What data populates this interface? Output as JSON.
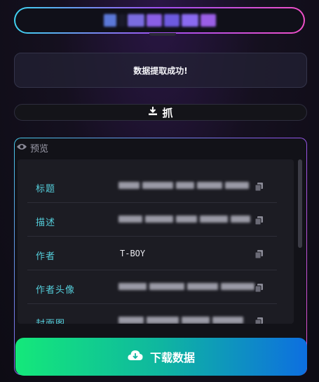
{
  "status": {
    "message": "数据提取成功!"
  },
  "grab_button": {
    "label": "抓"
  },
  "preview": {
    "label": "预览",
    "rows": [
      {
        "label": "标题",
        "value": null
      },
      {
        "label": "描述",
        "value": null
      },
      {
        "label": "作者",
        "value": "T-BOY"
      },
      {
        "label": "作者头像",
        "value": null
      },
      {
        "label": "封面图",
        "value": null
      }
    ]
  },
  "download_button": {
    "label": "下载数据"
  },
  "colors": {
    "accent_cyan": "#55cfdc",
    "gradient_start": "#14e87a",
    "gradient_end": "#0d6fe0"
  }
}
